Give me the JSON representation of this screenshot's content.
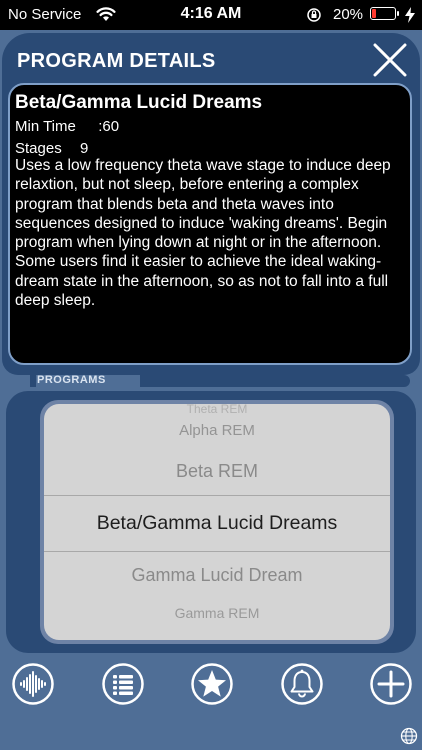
{
  "status_bar": {
    "carrier": "No Service",
    "time": "4:16 AM",
    "battery_percent": "20%",
    "battery_level": 0.2,
    "battery_color": "#ff3b30"
  },
  "details": {
    "title": "PROGRAM DETAILS",
    "program_name": "Beta/Gamma Lucid Dreams",
    "min_time_label": "Min Time",
    "min_time_value": ":60",
    "stages_label": "Stages",
    "stages_value": "9",
    "description": "Uses a low frequency theta wave stage to induce deep relaxtion, but not sleep, before entering a complex program that blends beta and theta waves into sequences designed to induce 'waking dreams'.  Begin program when lying down at night or in the afternoon.  Some users find it easier to achieve the ideal waking-dream state in the afternoon, so as not to fall into a full deep sleep."
  },
  "programs": {
    "label": "PROGRAMS",
    "items": [
      "Theta REM",
      "Alpha REM",
      "Beta REM",
      "Beta/Gamma Lucid Dreams",
      "Gamma Lucid Dream",
      "Gamma REM"
    ],
    "selected": "Beta/Gamma Lucid Dreams"
  },
  "toolbar": {
    "icons": [
      "waveform-icon",
      "list-icon",
      "star-icon",
      "bell-icon",
      "plus-icon"
    ]
  },
  "colors": {
    "background": "#4f6e96",
    "panel": "#2a4a75",
    "picker": "#d4d4d4"
  }
}
